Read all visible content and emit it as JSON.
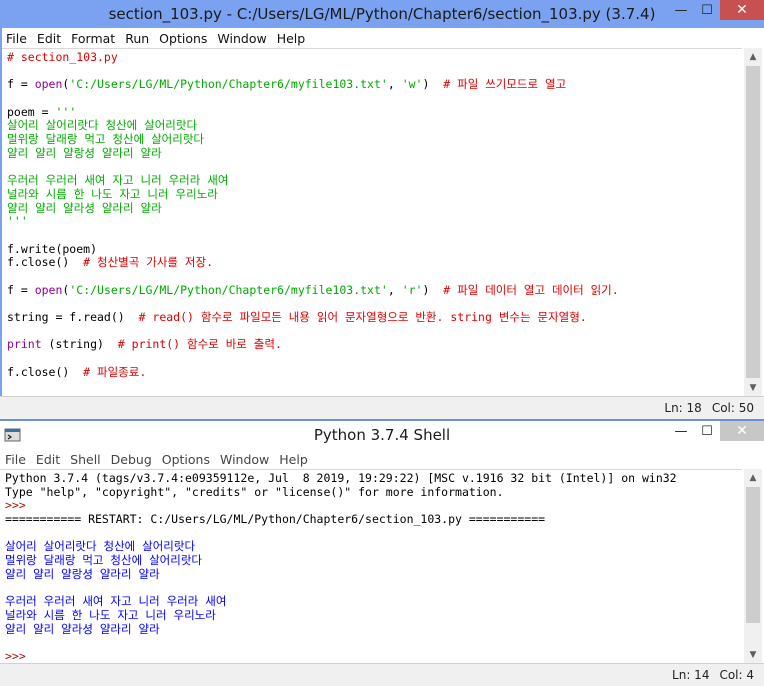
{
  "editor_window": {
    "title": "section_103.py - C:/Users/LG/ML/Python/Chapter6/section_103.py (3.7.4)",
    "menu": [
      "File",
      "Edit",
      "Format",
      "Run",
      "Options",
      "Window",
      "Help"
    ],
    "status": {
      "line": "Ln: 18",
      "col": "Col: 50"
    },
    "code_lines": [
      [
        {
          "t": "# section_103.py",
          "c": "cm"
        }
      ],
      [],
      [
        {
          "t": "f = ",
          "c": "tx"
        },
        {
          "t": "open",
          "c": "bi"
        },
        {
          "t": "(",
          "c": "tx"
        },
        {
          "t": "'C:/Users/LG/ML/Python/Chapter6/myfile103.txt'",
          "c": "str"
        },
        {
          "t": ", ",
          "c": "tx"
        },
        {
          "t": "'w'",
          "c": "str"
        },
        {
          "t": ")  ",
          "c": "tx"
        },
        {
          "t": "# 파일 쓰기모드로 열고",
          "c": "cm"
        }
      ],
      [],
      [
        {
          "t": "poem = ",
          "c": "tx"
        },
        {
          "t": "'''",
          "c": "str"
        }
      ],
      [
        {
          "t": "살어리 살어리랏다 청산에 살어리랏다",
          "c": "str"
        }
      ],
      [
        {
          "t": "멀위랑 달래랑 먹고 청산에 살어리랏다",
          "c": "str"
        }
      ],
      [
        {
          "t": "얄리 얄리 얄랑셩 얄라리 얄라",
          "c": "str"
        }
      ],
      [],
      [
        {
          "t": "우러러 우러러 새여 자고 니러 우러라 새여",
          "c": "str"
        }
      ],
      [
        {
          "t": "널라와 시름 한 나도 자고 니러 우리노라",
          "c": "str"
        }
      ],
      [
        {
          "t": "얄리 얄리 얄라셩 얄라리 얄라",
          "c": "str"
        }
      ],
      [
        {
          "t": "'''",
          "c": "str"
        }
      ],
      [],
      [
        {
          "t": "f.write(poem)",
          "c": "tx"
        }
      ],
      [
        {
          "t": "f.close()  ",
          "c": "tx"
        },
        {
          "t": "# 청산별곡 가사를 저장.",
          "c": "cm"
        }
      ],
      [],
      [
        {
          "t": "f = ",
          "c": "tx"
        },
        {
          "t": "open",
          "c": "bi"
        },
        {
          "t": "(",
          "c": "tx"
        },
        {
          "t": "'C:/Users/LG/ML/Python/Chapter6/myfile103.txt'",
          "c": "str"
        },
        {
          "t": ", ",
          "c": "tx"
        },
        {
          "t": "'r'",
          "c": "str"
        },
        {
          "t": ")  ",
          "c": "tx"
        },
        {
          "t": "# 파일 데이터 열고 데이터 읽기.",
          "c": "cm"
        }
      ],
      [],
      [
        {
          "t": "string = f.read()  ",
          "c": "tx"
        },
        {
          "t": "# read() 함수로 파일모든 내용 읽어 문자열형으로 반환. string 변수는 문자열형.",
          "c": "cm"
        }
      ],
      [],
      [
        {
          "t": "print",
          "c": "bi"
        },
        {
          "t": " (string)  ",
          "c": "tx"
        },
        {
          "t": "# print() 함수로 바로 출력.",
          "c": "cm"
        }
      ],
      [],
      [
        {
          "t": "f.close()  ",
          "c": "tx"
        },
        {
          "t": "# 파일종료.",
          "c": "cm"
        }
      ]
    ]
  },
  "shell_window": {
    "title": "Python 3.7.4 Shell",
    "menu": [
      "File",
      "Edit",
      "Shell",
      "Debug",
      "Options",
      "Window",
      "Help"
    ],
    "status": {
      "line": "Ln: 14",
      "col": "Col: 4"
    },
    "lines": [
      [
        {
          "t": "Python 3.7.4 (tags/v3.7.4:e09359112e, Jul  8 2019, 19:29:22) [MSC v.1916 32 bit (Intel)] on win32",
          "c": "tx"
        }
      ],
      [
        {
          "t": "Type \"help\", \"copyright\", \"credits\" or \"license()\" for more information.",
          "c": "tx"
        }
      ],
      [
        {
          "t": ">>> ",
          "c": "prompt"
        }
      ],
      [
        {
          "t": "=========== RESTART: C:/Users/LG/ML/Python/Chapter6/section_103.py ===========",
          "c": "tx"
        }
      ],
      [],
      [
        {
          "t": "살어리 살어리랏다 청산에 살어리랏다",
          "c": "out"
        }
      ],
      [
        {
          "t": "멀위랑 달래랑 먹고 청산에 살어리랏다",
          "c": "out"
        }
      ],
      [
        {
          "t": "얄리 얄리 얄랑셩 얄라리 얄라",
          "c": "out"
        }
      ],
      [],
      [
        {
          "t": "우러러 우러러 새여 자고 니러 우러라 새여",
          "c": "out"
        }
      ],
      [
        {
          "t": "널라와 시름 한 나도 자고 니러 우리노라",
          "c": "out"
        }
      ],
      [
        {
          "t": "얄리 얄리 얄라셩 얄라리 얄라",
          "c": "out"
        }
      ],
      [],
      [
        {
          "t": ">>> ",
          "c": "prompt"
        }
      ]
    ]
  },
  "icons": {
    "minimize": "minimize-icon",
    "maximize": "maximize-icon",
    "close": "close-icon",
    "app": "idle-python-icon"
  }
}
